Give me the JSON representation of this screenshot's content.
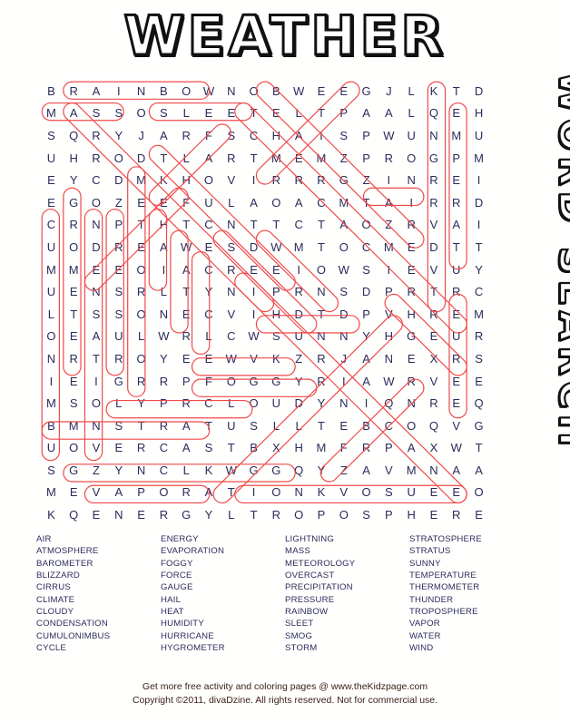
{
  "title": "WEATHER",
  "side_title": "WORD SEARCH",
  "colors": {
    "highlight": "#f04a4a",
    "letter": "#2b2b5a",
    "footer": "#3a1c12",
    "title_fill": "#ffffff",
    "title_stroke": "#111111"
  },
  "grid": {
    "rows": 21,
    "cols": 21,
    "letters": [
      "B R A I N B O W N O B W E E G J L K T D .",
      "M A S S O S L E E T E L T P A A L Q E H .",
      "S Q R Y J A R F S C H A I S P W U N M U .",
      "U H R O D T L A R T M E M Z P R O G P M .",
      "E Y C D M K H O V I R R R G Z I N R E I .",
      "E G O Z E E F U L A O A C M T A I R R D .",
      "C R N P T H T C N T T C T A O Z R V A I .",
      "U O D R E A W E S D W M T O C M E D T T .",
      "M M E E O I A C R E E I O W S I E V U Y .",
      "U E N S R L T Y N I P R N S D P R T R C .",
      "L T S S O N E C V I H D T D P V H R E M .",
      "O E A U L W R L C W S U N N Y H G E U R .",
      "N R T R O Y E E W V K Z R J A N E X R S .",
      "I E I G R R P F O G G Y R I A W R V E E .",
      "M S O L Y P R C L O U D Y N I Q N R E Q .",
      "B M N S T R A T U S L L T E B C O Q V G .",
      "U O V E R C A S T B X H M F R P A X W T .",
      "S G Z Y N C L K W G G Q Y Z A V M N A A .",
      "M E V A P O R A T I O N K V O S U E E O .",
      "K Q E N E R G Y L T R O P O S P H E R E ."
    ]
  },
  "word_list": {
    "columns": [
      [
        "AIR",
        "ATMOSPHERE",
        "BAROMETER",
        "BLIZZARD",
        "CIRRUS",
        "CLIMATE",
        "CLOUDY",
        "CONDENSATION",
        "CUMULONIMBUS",
        "CYCLE"
      ],
      [
        "ENERGY",
        "EVAPORATION",
        "FOGGY",
        "FORCE",
        "GAUGE",
        "HAIL",
        "HEAT",
        "HUMIDITY",
        "HURRICANE",
        "HYGROMETER"
      ],
      [
        "LIGHTNING",
        "MASS",
        "METEOROLOGY",
        "OVERCAST",
        "PRECIPITATION",
        "PRESSURE",
        "RAINBOW",
        "SLEET",
        "SMOG",
        "STORM"
      ],
      [
        "STRATOSPHERE",
        "STRATUS",
        "SUNNY",
        "TEMPERATURE",
        "THERMOMETER",
        "THUNDER",
        "TROPOSPHERE",
        "VAPOR",
        "WATER",
        "WIND"
      ]
    ]
  },
  "footer": {
    "line1": "Get more free activity and coloring pages @ www.theKidzpage.com",
    "line2": "Copyright ©2011, divaDzine.  All rights reserved. Not for commercial use."
  },
  "highlights": [
    {
      "word": "RAINBOW",
      "r1": 0,
      "c1": 1,
      "r2": 0,
      "c2": 7
    },
    {
      "word": "MASS",
      "r1": 1,
      "c1": 0,
      "r2": 1,
      "c2": 3
    },
    {
      "word": "SLEET",
      "r1": 1,
      "c1": 5,
      "r2": 1,
      "c2": 9
    },
    {
      "word": "AIR",
      "r1": 5,
      "c1": 15,
      "r2": 5,
      "c2": 17
    },
    {
      "word": "SUNNY",
      "r1": 11,
      "c1": 10,
      "r2": 11,
      "c2": 14
    },
    {
      "word": "FOGGY",
      "r1": 13,
      "c1": 7,
      "r2": 13,
      "c2": 11
    },
    {
      "word": "CLOUDY",
      "r1": 14,
      "c1": 7,
      "r2": 14,
      "c2": 12
    },
    {
      "word": "STRATUS",
      "r1": 15,
      "c1": 3,
      "r2": 15,
      "c2": 9
    },
    {
      "word": "OVERCAST",
      "r1": 16,
      "c1": 0,
      "r2": 16,
      "c2": 7
    },
    {
      "word": "EVAPORATION",
      "r1": 18,
      "c1": 1,
      "r2": 18,
      "c2": 11
    },
    {
      "word": "ENERGY",
      "r1": 19,
      "c1": 2,
      "r2": 19,
      "c2": 7
    },
    {
      "word": "TROPOSPHERE",
      "r1": 19,
      "c1": 9,
      "r2": 19,
      "c2": 19
    },
    {
      "word": "CUMULONIMBUS",
      "r1": 6,
      "c1": 0,
      "r2": 17,
      "c2": 0
    },
    {
      "word": "BAROMETER",
      "r1": 5,
      "c1": 1,
      "r2": 13,
      "c2": 1
    },
    {
      "word": "CONDENSATION",
      "r1": 6,
      "c1": 2,
      "r2": 17,
      "c2": 2
    },
    {
      "word": "PRESSURE",
      "r1": 6,
      "c1": 3,
      "r2": 13,
      "c2": 3
    },
    {
      "word": "METEOROLOGY",
      "r1": 4,
      "c1": 4,
      "r2": 14,
      "c2": 4
    },
    {
      "word": "HAIL",
      "r1": 6,
      "c1": 5,
      "r2": 9,
      "c2": 5
    },
    {
      "word": "WATER",
      "r1": 7,
      "c1": 6,
      "r2": 11,
      "c2": 6
    },
    {
      "word": "CYCLE",
      "r1": 8,
      "c1": 7,
      "r2": 12,
      "c2": 7
    },
    {
      "word": "TEMPERATURE",
      "r1": 0,
      "c1": 18,
      "r2": 10,
      "c2": 18
    },
    {
      "word": "HUMIDITY",
      "r1": 1,
      "c1": 19,
      "r2": 8,
      "c2": 19
    },
    {
      "word": "SMOG",
      "r1": 2,
      "c1": 8,
      "r2": 5,
      "c2": 5
    },
    {
      "word": "CIRRUS",
      "r1": 15,
      "c1": 19,
      "r2": 10,
      "c2": 19
    },
    {
      "word": "THERMOMETER",
      "r1": 1,
      "c1": 9,
      "r2": 11,
      "c2": 19
    },
    {
      "word": "GAUGE",
      "r1": 0,
      "c1": 14,
      "r2": 4,
      "c2": 10
    },
    {
      "word": "BLIZZARD",
      "r1": 0,
      "c1": 10,
      "r2": 7,
      "c2": 17
    },
    {
      "word": "ATMOSPHERE",
      "r1": 1,
      "c1": 1,
      "r2": 10,
      "c2": 10
    },
    {
      "word": "CLIMATE",
      "r1": 3,
      "c1": 5,
      "r2": 9,
      "c2": 11
    },
    {
      "word": "FORCE",
      "r1": 5,
      "c1": 6,
      "r2": 9,
      "c2": 2
    },
    {
      "word": "WIND",
      "r1": 7,
      "c1": 10,
      "r2": 10,
      "c2": 13
    },
    {
      "word": "STORM",
      "r1": 7,
      "c1": 8,
      "r2": 11,
      "c2": 12
    },
    {
      "word": "VAPOR",
      "r1": 18,
      "c1": 13,
      "r2": 14,
      "c2": 17
    },
    {
      "word": "HEAT",
      "r1": 10,
      "c1": 16,
      "r2": 13,
      "c2": 19
    },
    {
      "word": "PRECIPITATION",
      "r1": 9,
      "c1": 9,
      "r2": 19,
      "c2": 19
    },
    {
      "word": "LIGHTNING",
      "r1": 19,
      "c1": 8,
      "r2": 11,
      "c2": 16
    }
  ]
}
